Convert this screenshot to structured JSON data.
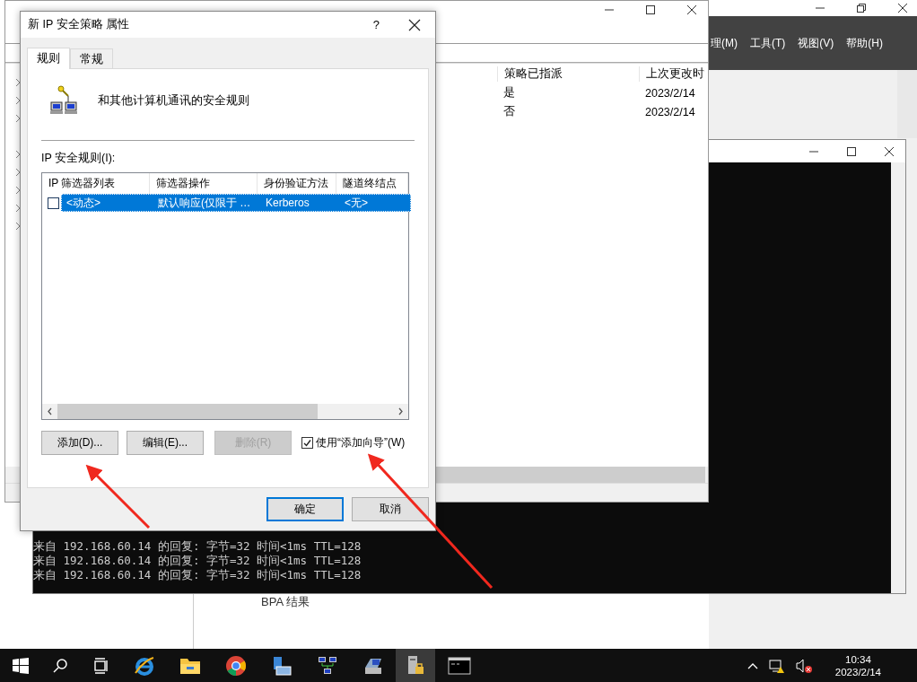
{
  "policy_window": {
    "columns": [
      "策略已指派",
      "上次更改时"
    ],
    "rows": [
      [
        "是",
        "2023/2/14"
      ],
      [
        "否",
        "2023/2/14"
      ]
    ]
  },
  "server_manager": {
    "menu": [
      "理(M)",
      "工具(T)",
      "视图(V)",
      "帮助(H)"
    ],
    "panel_label": "BPA 结果"
  },
  "console": {
    "lines": [
      "来自 192.168.60.14 的回复: 字节=32 时间<1ms TTL=128",
      "来自 192.168.60.14 的回复: 字节=32 时间<1ms TTL=128",
      "来自 192.168.60.14 的回复: 字节=32 时间<1ms TTL=128"
    ]
  },
  "dialog": {
    "title": "新 IP 安全策略 属性",
    "help": "?",
    "tabs": [
      {
        "label": "规则",
        "selected": true
      },
      {
        "label": "常规",
        "selected": false
      }
    ],
    "description": "和其他计算机通讯的安全规则",
    "rules_label": "IP 安全规则(I):",
    "columns": [
      "IP 筛选器列表",
      "筛选器操作",
      "身份验证方法",
      "隧道终结点"
    ],
    "rows": [
      {
        "checked": false,
        "selected": true,
        "cells": [
          "<动态>",
          "默认响应(仅限于 …",
          "Kerberos",
          "<无>"
        ]
      }
    ],
    "buttons": [
      {
        "label": "添加(D)...",
        "disabled": false
      },
      {
        "label": "编辑(E)...",
        "disabled": false
      },
      {
        "label": "删除(R)",
        "disabled": true
      }
    ],
    "wizard": {
      "label": "使用“添加向导”(W)",
      "checked": true
    },
    "ok": "确定",
    "cancel": "取消"
  },
  "taskbar": {
    "time": "10:34",
    "date": "2023/2/14"
  }
}
